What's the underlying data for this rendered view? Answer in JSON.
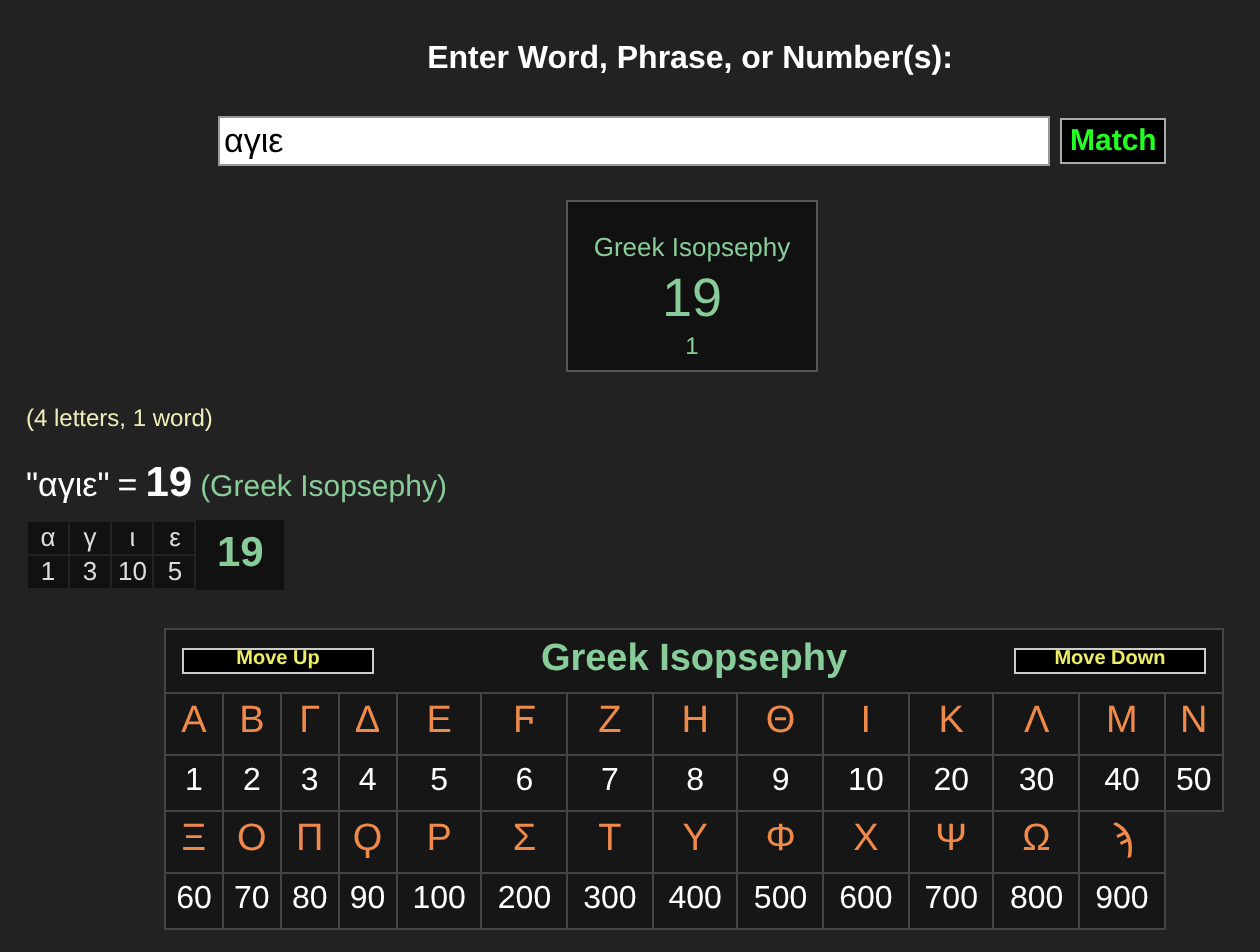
{
  "prompt": "Enter Word, Phrase, or Number(s):",
  "input": {
    "value": "αγιε"
  },
  "match_button": "Match",
  "result_box": {
    "cipher": "Greek Isopsephy",
    "value": "19",
    "count": "1"
  },
  "stats": "(4 letters, 1 word)",
  "summary": {
    "phrase": "\"αγιε\"",
    "equals": "=",
    "value": "19",
    "cipher": "(Greek Isopsephy)"
  },
  "breakdown": {
    "letters": [
      {
        "letter": "α",
        "value": "1"
      },
      {
        "letter": "γ",
        "value": "3"
      },
      {
        "letter": "ι",
        "value": "10"
      },
      {
        "letter": "ε",
        "value": "5"
      }
    ],
    "total": "19"
  },
  "cipher_table": {
    "move_up": "Move Up",
    "title": "Greek Isopsephy",
    "move_down": "Move Down",
    "rows": [
      [
        {
          "letter": "Α",
          "value": "1"
        },
        {
          "letter": "Β",
          "value": "2"
        },
        {
          "letter": "Γ",
          "value": "3"
        },
        {
          "letter": "Δ",
          "value": "4"
        },
        {
          "letter": "Ε",
          "value": "5"
        },
        {
          "letter": "Ϝ",
          "value": "6"
        },
        {
          "letter": "Ζ",
          "value": "7"
        },
        {
          "letter": "Η",
          "value": "8"
        },
        {
          "letter": "Θ",
          "value": "9"
        },
        {
          "letter": "Ι",
          "value": "10"
        },
        {
          "letter": "Κ",
          "value": "20"
        },
        {
          "letter": "Λ",
          "value": "30"
        },
        {
          "letter": "Μ",
          "value": "40"
        },
        {
          "letter": "Ν",
          "value": "50"
        }
      ],
      [
        {
          "letter": "Ξ",
          "value": "60"
        },
        {
          "letter": "Ο",
          "value": "70"
        },
        {
          "letter": "Π",
          "value": "80"
        },
        {
          "letter": "Ϙ",
          "value": "90"
        },
        {
          "letter": "Ρ",
          "value": "100"
        },
        {
          "letter": "Σ",
          "value": "200"
        },
        {
          "letter": "Τ",
          "value": "300"
        },
        {
          "letter": "Υ",
          "value": "400"
        },
        {
          "letter": "Φ",
          "value": "500"
        },
        {
          "letter": "Χ",
          "value": "600"
        },
        {
          "letter": "Ψ",
          "value": "700"
        },
        {
          "letter": "Ω",
          "value": "800"
        },
        {
          "letter": "ϡ",
          "value": "900"
        }
      ]
    ]
  }
}
